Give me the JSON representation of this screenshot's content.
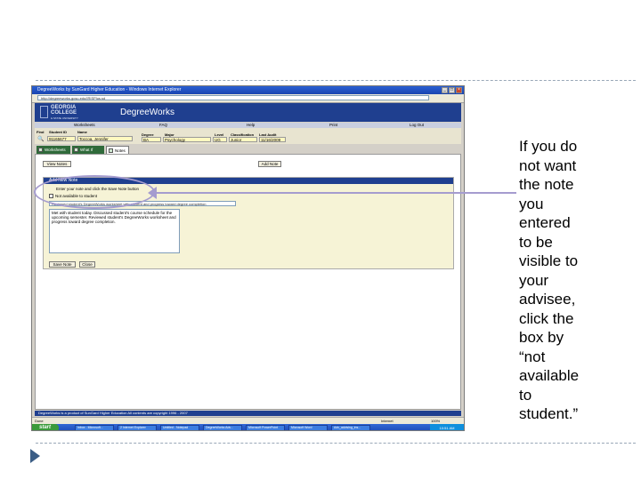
{
  "window": {
    "title": "DegreeWorks by SunGard Higher Education - Windows Internet Explorer",
    "address": "http://degreeworks.gcsu.edu/IRISPlus.sd"
  },
  "header": {
    "logo_line1": "GEORGIA",
    "logo_line2": "COLLEGE",
    "logo_line3": "& STATE UNIVERSITY",
    "app_name": "DegreeWorks"
  },
  "menu": [
    "Worksheets",
    "FAQ",
    "Help",
    "Print",
    "Log Out"
  ],
  "student": {
    "labels": {
      "find": "Find",
      "id": "Student ID",
      "name": "Name",
      "degree": "Degree",
      "major": "Major",
      "level": "Level",
      "classification": "Classification",
      "last_audit": "Last Audit"
    },
    "id_value": "91165677",
    "name_value": "Toccoa, Jennifer",
    "degree_value": "BA",
    "major_value": "Psychology",
    "level_value": "UG",
    "classification_value": "Junior",
    "last_audit_value": "11/16/2009"
  },
  "tabs": [
    "Worksheets",
    "What If",
    "Notes"
  ],
  "notes": {
    "view_button": "View Notes",
    "add_button": "Add Note",
    "panel_title": "Add New Note",
    "instructions": "Enter your note and click the Save Note button",
    "checkbox_label": "Not available to student",
    "predefined_select": "Reviewed student's DegreeWorks worksheet with student and progress toward degree completion",
    "note_text": "Met with student today. Discussed student's course schedule for the upcoming semester. Reviewed student's DegreeWorks worksheet and progress toward degree completion.",
    "save_button": "Save Note",
    "close_button": "Close"
  },
  "footer": "DegreeWorks is a product of SunGard Higher Education All contents are copyright 1996 - 2007",
  "statusbar": {
    "left": "Done",
    "zone": "Internet",
    "zoom": "100%"
  },
  "taskbar": {
    "start": "start",
    "items": [
      "Inbox - Microsoft...",
      "2 Internet Explorer",
      "Untitled - Notepad",
      "DegreeWorks Adv...",
      "Microsoft PowerPoint",
      "Microsoft Word",
      "Adv_advising_ins..."
    ],
    "clock": "10:51 AM"
  },
  "callout": "If you do\nnot want\nthe note\nyou\nentered\nto be\nvisible to\nyour\nadvisee,\nclick the\nbox by\n   “not\navailable\nto\nstudent.”",
  "colors": {
    "header_blue": "#1f3f8f",
    "tab_green": "#2f6a3a",
    "callout_purple": "#a59ccf",
    "field_yellow": "#fff8c0"
  }
}
